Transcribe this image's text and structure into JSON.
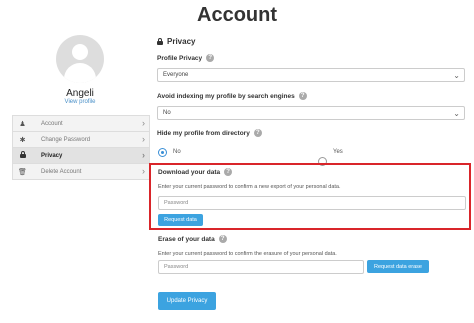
{
  "page": {
    "title": "Account"
  },
  "profile": {
    "name": "Angeli",
    "view_profile": "View profile"
  },
  "sidebar": {
    "items": [
      {
        "label": "Account",
        "icon": "user-icon"
      },
      {
        "label": "Change Password",
        "icon": "asterisk-icon"
      },
      {
        "label": "Privacy",
        "icon": "lock-icon",
        "active": true
      },
      {
        "label": "Delete Account",
        "icon": "trash-icon"
      }
    ]
  },
  "privacy": {
    "heading": "Privacy",
    "profile_privacy": {
      "label": "Profile Privacy",
      "value": "Everyone"
    },
    "indexing": {
      "label": "Avoid indexing my profile by search engines",
      "value": "No"
    },
    "hide_directory": {
      "label": "Hide my profile from directory",
      "options": [
        "No",
        "Yes"
      ],
      "selected": "No"
    }
  },
  "download": {
    "label": "Download your data",
    "description": "Enter your current password to confirm a new export of your personal data.",
    "placeholder": "Password",
    "button": "Request data"
  },
  "erase": {
    "label": "Erase of your data",
    "description": "Enter your current password to confirm the erasure of your personal data.",
    "placeholder": "Password",
    "button": "Request data erase"
  },
  "submit": {
    "label": "Update Privacy"
  },
  "colors": {
    "accent": "#3ca3e0",
    "highlight_border": "#d9252a"
  }
}
